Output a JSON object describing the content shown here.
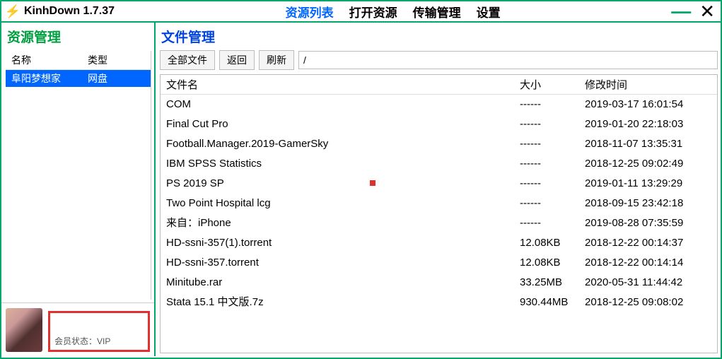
{
  "app": {
    "title": "KinhDown 1.7.37"
  },
  "nav": {
    "items": [
      {
        "label": "资源列表",
        "active": true
      },
      {
        "label": "打开资源",
        "active": false
      },
      {
        "label": "传输管理",
        "active": false
      },
      {
        "label": "设置",
        "active": false
      }
    ]
  },
  "sidebar": {
    "title": "资源管理",
    "header": {
      "name": "名称",
      "type": "类型"
    },
    "rows": [
      {
        "name": "阜阳梦想家",
        "type": "网盘"
      }
    ],
    "vip_label": "会员状态：VIP"
  },
  "main": {
    "title": "文件管理",
    "toolbar": {
      "all_files": "全部文件",
      "back": "返回",
      "refresh": "刷新",
      "path": "/"
    },
    "columns": {
      "name": "文件名",
      "size": "大小",
      "mtime": "修改时间"
    },
    "rows": [
      {
        "name": "COM",
        "size": "------",
        "mtime": "2019-03-17 16:01:54",
        "mark": false
      },
      {
        "name": "Final Cut Pro",
        "size": "------",
        "mtime": "2019-01-20 22:18:03",
        "mark": false
      },
      {
        "name": "Football.Manager.2019-GamerSky",
        "size": "------",
        "mtime": "2018-11-07 13:35:31",
        "mark": false
      },
      {
        "name": "IBM SPSS Statistics",
        "size": "------",
        "mtime": "2018-12-25 09:02:49",
        "mark": false
      },
      {
        "name": "PS 2019 SP",
        "size": "------",
        "mtime": "2019-01-11 13:29:29",
        "mark": true
      },
      {
        "name": "Two Point Hospital lcg",
        "size": "------",
        "mtime": "2018-09-15 23:42:18",
        "mark": false
      },
      {
        "name": "来自：iPhone",
        "size": "------",
        "mtime": "2019-08-28 07:35:59",
        "mark": false
      },
      {
        "name": "HD-ssni-357(1).torrent",
        "size": "12.08KB",
        "mtime": "2018-12-22 00:14:37",
        "mark": false
      },
      {
        "name": "HD-ssni-357.torrent",
        "size": "12.08KB",
        "mtime": "2018-12-22 00:14:14",
        "mark": false
      },
      {
        "name": "Minitube.rar",
        "size": "33.25MB",
        "mtime": "2020-05-31 11:44:42",
        "mark": false
      },
      {
        "name": "Stata 15.1 中文版.7z",
        "size": "930.44MB",
        "mtime": "2018-12-25 09:08:02",
        "mark": false
      }
    ]
  }
}
